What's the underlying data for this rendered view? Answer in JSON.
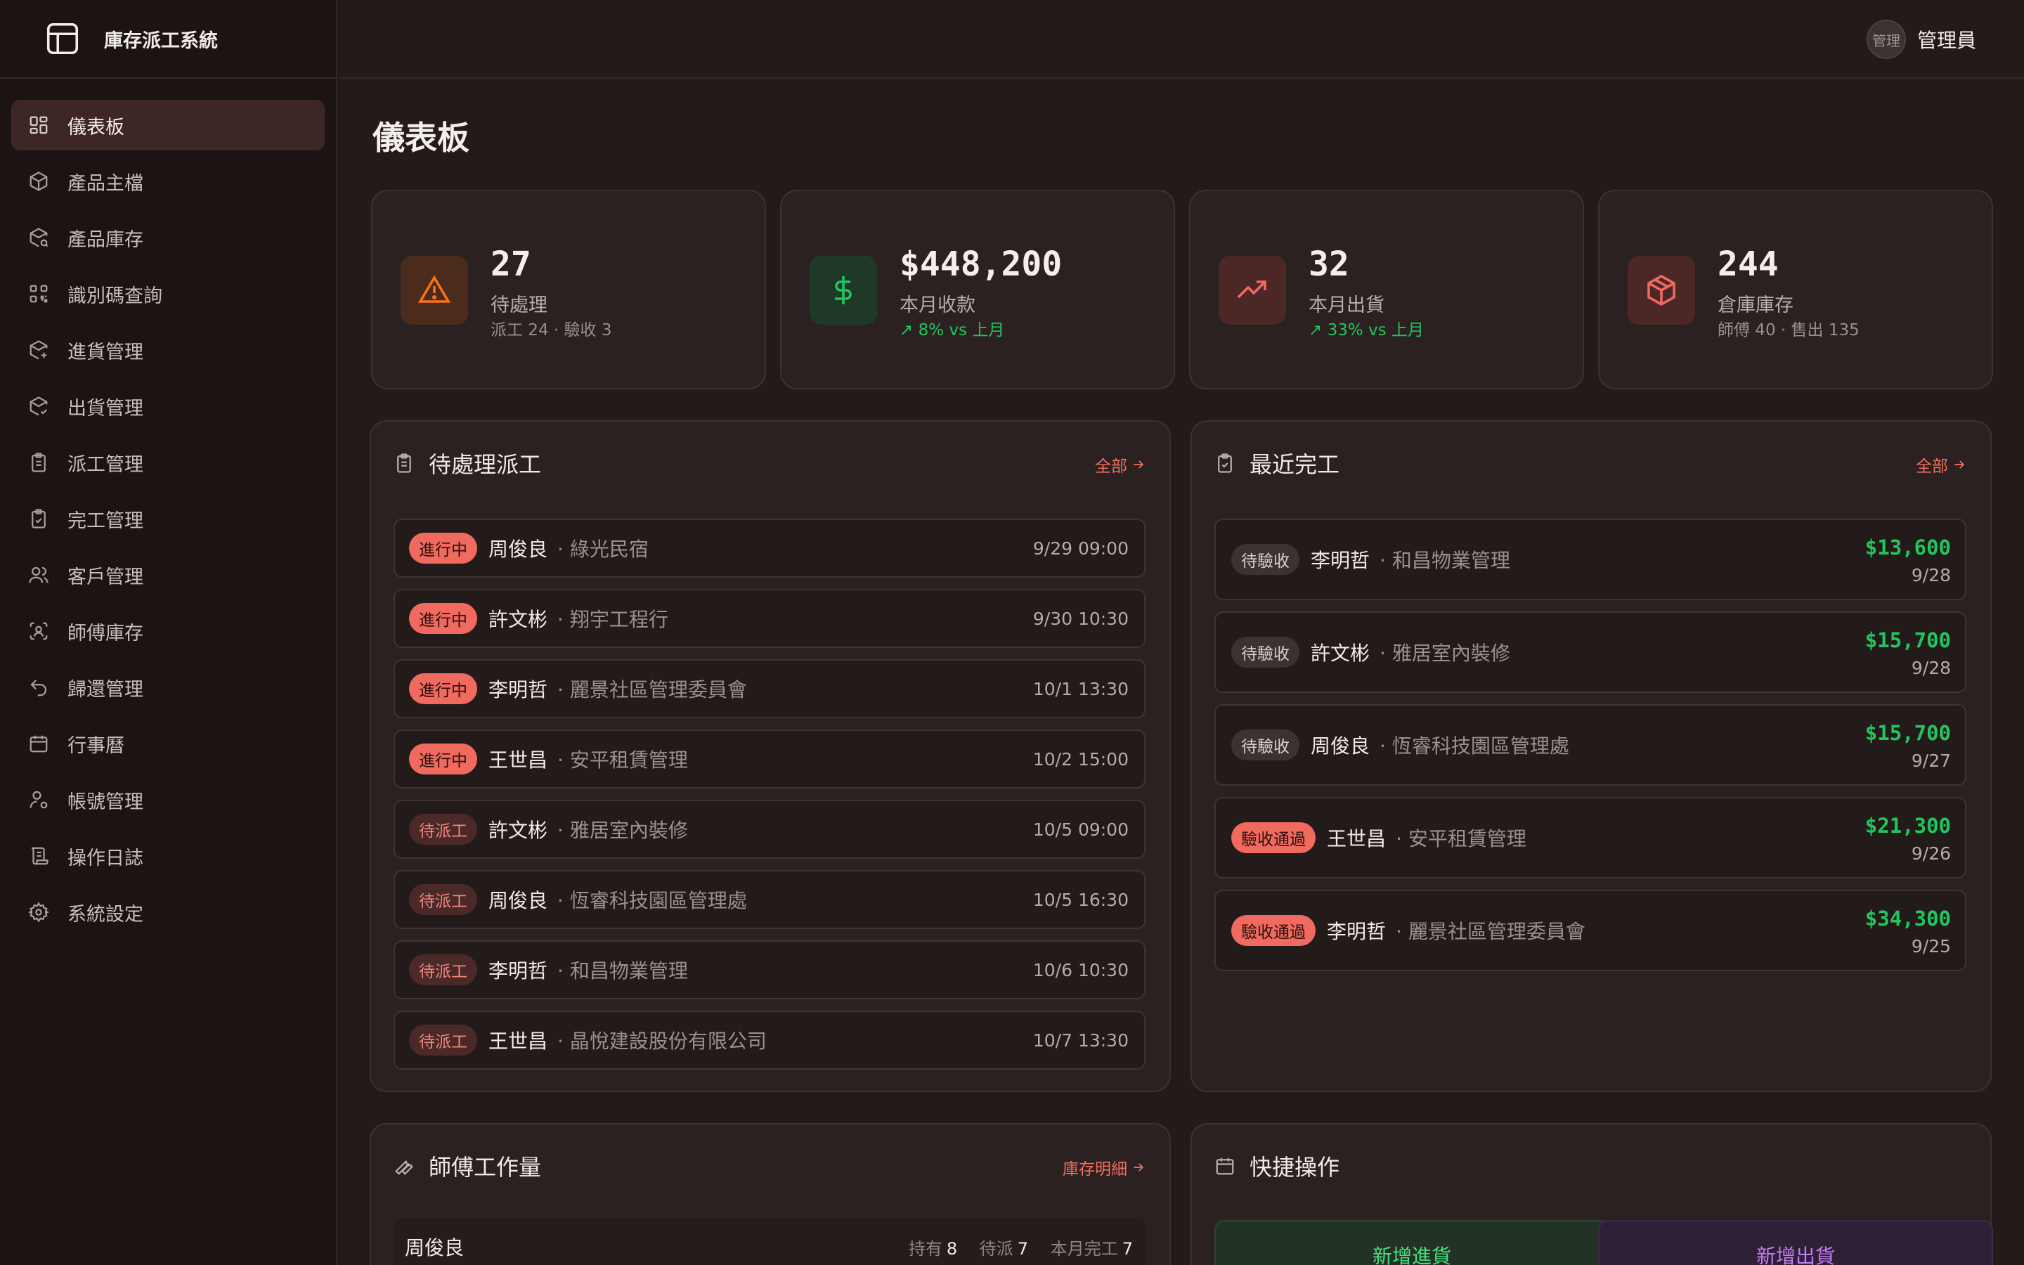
{
  "app": {
    "title": "庫存派工系統"
  },
  "sidebar": {
    "items": [
      {
        "label": "儀表板"
      },
      {
        "label": "產品主檔"
      },
      {
        "label": "產品庫存"
      },
      {
        "label": "識別碼查詢"
      },
      {
        "label": "進貨管理"
      },
      {
        "label": "出貨管理"
      },
      {
        "label": "派工管理"
      },
      {
        "label": "完工管理"
      },
      {
        "label": "客戶管理"
      },
      {
        "label": "師傅庫存"
      },
      {
        "label": "歸還管理"
      },
      {
        "label": "行事曆"
      },
      {
        "label": "帳號管理"
      },
      {
        "label": "操作日誌"
      },
      {
        "label": "系統設定"
      }
    ]
  },
  "header": {
    "avatar_text": "管理",
    "user_name": "管理員"
  },
  "page": {
    "title": "儀表板"
  },
  "stats": [
    {
      "value": "27",
      "label": "待處理",
      "sub": "派工 24 · 驗收 3",
      "color": "#f97316"
    },
    {
      "value": "$448,200",
      "label": "本月收款",
      "sub": "8% vs 上月",
      "color": "#22c55e"
    },
    {
      "value": "32",
      "label": "本月出貨",
      "sub": "33% vs 上月",
      "color": "#f16a5f"
    },
    {
      "value": "244",
      "label": "倉庫庫存",
      "sub": "師傅 40 · 售出 135",
      "color": "#f16a5f"
    }
  ],
  "pending": {
    "title": "待處理派工",
    "link": "全部",
    "rows": [
      {
        "status": "進行中",
        "name": "周俊良",
        "client": "· 綠光民宿",
        "time": "9/29 09:00"
      },
      {
        "status": "進行中",
        "name": "許文彬",
        "client": "· 翔宇工程行",
        "time": "9/30 10:30"
      },
      {
        "status": "進行中",
        "name": "李明哲",
        "client": "· 麗景社區管理委員會",
        "time": "10/1 13:30"
      },
      {
        "status": "進行中",
        "name": "王世昌",
        "client": "· 安平租賃管理",
        "time": "10/2 15:00"
      },
      {
        "status": "待派工",
        "name": "許文彬",
        "client": "· 雅居室內裝修",
        "time": "10/5 09:00"
      },
      {
        "status": "待派工",
        "name": "周俊良",
        "client": "· 恆睿科技園區管理處",
        "time": "10/5 16:30"
      },
      {
        "status": "待派工",
        "name": "李明哲",
        "client": "· 和昌物業管理",
        "time": "10/6 10:30"
      },
      {
        "status": "待派工",
        "name": "王世昌",
        "client": "· 晶悅建設股份有限公司",
        "time": "10/7 13:30"
      }
    ]
  },
  "completed": {
    "title": "最近完工",
    "link": "全部",
    "rows": [
      {
        "status": "待驗收",
        "name": "李明哲",
        "client": "· 和昌物業管理",
        "amount": "$13,600",
        "date": "9/28"
      },
      {
        "status": "待驗收",
        "name": "許文彬",
        "client": "· 雅居室內裝修",
        "amount": "$15,700",
        "date": "9/28"
      },
      {
        "status": "待驗收",
        "name": "周俊良",
        "client": "· 恆睿科技園區管理處",
        "amount": "$15,700",
        "date": "9/27"
      },
      {
        "status": "驗收通過",
        "name": "王世昌",
        "client": "· 安平租賃管理",
        "amount": "$21,300",
        "date": "9/26"
      },
      {
        "status": "驗收通過",
        "name": "李明哲",
        "client": "· 麗景社區管理委員會",
        "amount": "$34,300",
        "date": "9/25"
      }
    ]
  },
  "workload": {
    "title": "師傅工作量",
    "link": "庫存明細",
    "rows": [
      {
        "name": "周俊良",
        "hold_label": "持有",
        "hold": "8",
        "pending_label": "待派",
        "pending": "7",
        "month_label": "本月完工",
        "month": "7"
      }
    ]
  },
  "quick": {
    "title": "快捷操作",
    "buttons": [
      {
        "label": "新增進貨"
      },
      {
        "label": "新增出貨"
      }
    ]
  }
}
